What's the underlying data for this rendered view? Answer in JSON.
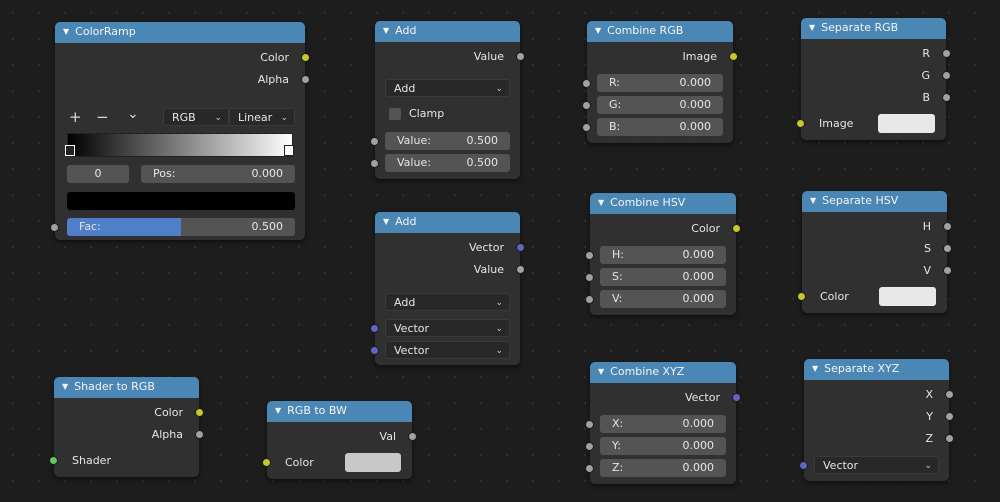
{
  "colorramp": {
    "title": "ColorRamp",
    "out_color": "Color",
    "out_alpha": "Alpha",
    "plus": "+",
    "minus": "−",
    "chevron": "⌄",
    "mode": "RGB",
    "interp": "Linear",
    "index": "0",
    "pos_label": "Pos:",
    "pos_value": "0.000",
    "fac_label": "Fac:",
    "fac_value": "0.500",
    "fac_fraction": 0.5,
    "stop_color": "#000000"
  },
  "add1": {
    "title": "Add",
    "out_value": "Value",
    "operation": "Add",
    "clamp_label": "Clamp",
    "v1_label": "Value:",
    "v1": "0.500",
    "v2_label": "Value:",
    "v2": "0.500"
  },
  "add2": {
    "title": "Add",
    "out_vector": "Vector",
    "out_value": "Value",
    "operation": "Add",
    "in1": "Vector",
    "in2": "Vector"
  },
  "combine_rgb": {
    "title": "Combine RGB",
    "out": "Image",
    "fields": [
      {
        "label": "R:",
        "value": "0.000"
      },
      {
        "label": "G:",
        "value": "0.000"
      },
      {
        "label": "B:",
        "value": "0.000"
      }
    ]
  },
  "separate_rgb": {
    "title": "Separate RGB",
    "outs": [
      "R",
      "G",
      "B"
    ],
    "in_label": "Image"
  },
  "combine_hsv": {
    "title": "Combine HSV",
    "out": "Color",
    "fields": [
      {
        "label": "H:",
        "value": "0.000"
      },
      {
        "label": "S:",
        "value": "0.000"
      },
      {
        "label": "V:",
        "value": "0.000"
      }
    ]
  },
  "separate_hsv": {
    "title": "Separate HSV",
    "outs": [
      "H",
      "S",
      "V"
    ],
    "in_label": "Color"
  },
  "combine_xyz": {
    "title": "Combine XYZ",
    "out": "Vector",
    "fields": [
      {
        "label": "X:",
        "value": "0.000"
      },
      {
        "label": "Y:",
        "value": "0.000"
      },
      {
        "label": "Z:",
        "value": "0.000"
      }
    ]
  },
  "separate_xyz": {
    "title": "Separate XYZ",
    "outs": [
      "X",
      "Y",
      "Z"
    ],
    "in_dropdown": "Vector"
  },
  "shader_to_rgb": {
    "title": "Shader to RGB",
    "out_color": "Color",
    "out_alpha": "Alpha",
    "in_label": "Shader"
  },
  "rgb_to_bw": {
    "title": "RGB to BW",
    "out": "Val",
    "in_label": "Color"
  },
  "colors": {
    "header": "#4a87b5",
    "node_body": "#303030",
    "socket_gray": "#a1a1a1",
    "socket_yellow": "#c7c729",
    "socket_purple": "#6363c7",
    "socket_green": "#63c763",
    "fac_bar": "#4e7fc8",
    "swatch_white": "#e8e8e8",
    "swatch_gray": "#c8c8c8"
  }
}
